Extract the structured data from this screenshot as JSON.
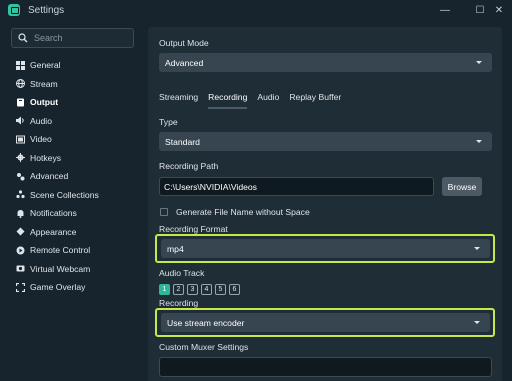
{
  "window": {
    "title": "Settings",
    "minimize": "—",
    "maximize": "☐",
    "close": "✕"
  },
  "search": {
    "placeholder": "Search"
  },
  "sidebar": {
    "items": [
      {
        "label": "General",
        "icon": "grid-icon"
      },
      {
        "label": "Stream",
        "icon": "globe-icon"
      },
      {
        "label": "Output",
        "icon": "output-icon",
        "active": true
      },
      {
        "label": "Audio",
        "icon": "speaker-icon"
      },
      {
        "label": "Video",
        "icon": "video-icon"
      },
      {
        "label": "Hotkeys",
        "icon": "gear-icon"
      },
      {
        "label": "Advanced",
        "icon": "advanced-icon"
      },
      {
        "label": "Scene Collections",
        "icon": "scenes-icon"
      },
      {
        "label": "Notifications",
        "icon": "bell-icon"
      },
      {
        "label": "Appearance",
        "icon": "appearance-icon"
      },
      {
        "label": "Remote Control",
        "icon": "remote-icon"
      },
      {
        "label": "Virtual Webcam",
        "icon": "webcam-icon"
      },
      {
        "label": "Game Overlay",
        "icon": "overlay-icon"
      }
    ]
  },
  "output": {
    "mode_label": "Output Mode",
    "mode_value": "Advanced",
    "tabs": [
      "Streaming",
      "Recording",
      "Audio",
      "Replay Buffer"
    ],
    "active_tab": "Recording",
    "type_label": "Type",
    "type_value": "Standard",
    "path_label": "Recording Path",
    "path_value": "C:\\Users\\NVIDIA\\Videos",
    "browse_label": "Browse",
    "gen_filename_label": "Generate File Name without Space",
    "gen_filename_checked": false,
    "format_label": "Recording Format",
    "format_value": "mp4",
    "audio_track_label": "Audio Track",
    "tracks": [
      "1",
      "2",
      "3",
      "4",
      "5",
      "6"
    ],
    "active_track": "1",
    "recording_label": "Recording",
    "encoder_value": "Use stream encoder",
    "muxer_label": "Custom Muxer Settings",
    "muxer_value": ""
  },
  "colors": {
    "accent": "#31b59a",
    "highlight": "#c6e84b",
    "panel": "#1f2d36",
    "background": "#17242d"
  }
}
